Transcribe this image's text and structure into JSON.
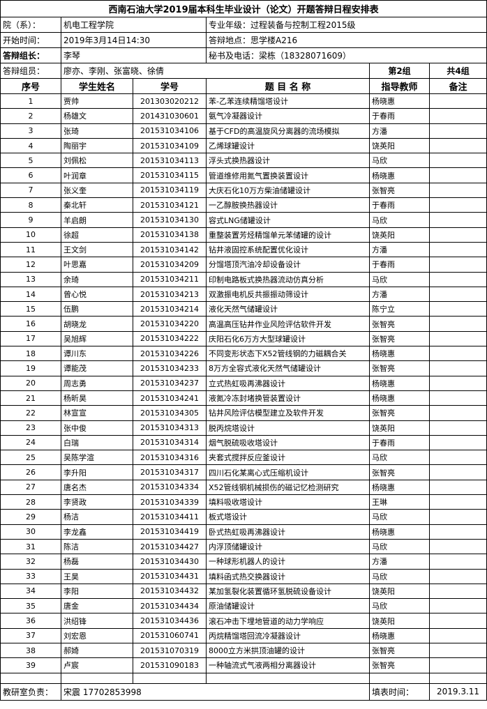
{
  "title": "西南石油大学2019届本科生毕业设计（论文）开题答辩日程安排表",
  "info": {
    "college_label": "院（系）：",
    "college_value": "机电工程学院",
    "major": "专业年级：过程装备与控制工程2015级",
    "start_label": "开始时间：",
    "start_value": "2019年3月14日14:30",
    "place": "答辩地点：思学楼A216",
    "leader_label": "答辩组长：",
    "leader_value": "李琴",
    "secretary": "秘书及电话：梁栋（18328071609）",
    "members_label": "答辩组员：",
    "members_value": "廖亦、李刚、张富晓、徐倩",
    "group": "第2组",
    "total": "共4组"
  },
  "headers": [
    "序号",
    "学生姓名",
    "学号",
    "题 目 名 称",
    "指导教师",
    "备注"
  ],
  "rows": [
    {
      "no": "1",
      "name": "贾帅",
      "id": "201303020212",
      "topic": "苯-乙苯连续精馏塔设计",
      "advisor": "杨晓惠",
      "note": ""
    },
    {
      "no": "2",
      "name": "杨雄文",
      "id": "201431030601",
      "topic": "氨气冷凝器设计",
      "advisor": "于春雨",
      "note": ""
    },
    {
      "no": "3",
      "name": "张琦",
      "id": "201531034106",
      "topic": "基于CFD的高温旋风分离器的流场模拟",
      "advisor": "方潘",
      "note": ""
    },
    {
      "no": "4",
      "name": "陶丽宇",
      "id": "201531034109",
      "topic": "乙烯球罐设计",
      "advisor": "饶英阳",
      "note": ""
    },
    {
      "no": "5",
      "name": "刘佩松",
      "id": "201531034113",
      "topic": "浮头式换热器设计",
      "advisor": "马欣",
      "note": ""
    },
    {
      "no": "6",
      "name": "叶润章",
      "id": "201531034115",
      "topic": "管道维修用氮气置换装置设计",
      "advisor": "杨晓惠",
      "note": ""
    },
    {
      "no": "7",
      "name": "张义奎",
      "id": "201531034119",
      "topic": "大庆石化10万方柴油储罐设计",
      "advisor": "张智亮",
      "note": ""
    },
    {
      "no": "8",
      "name": "秦北轩",
      "id": "201531034121",
      "topic": "一乙醇胺换热器设计",
      "advisor": "于春雨",
      "note": ""
    },
    {
      "no": "9",
      "name": "羊启朗",
      "id": "201531034130",
      "topic": "容式LNG储罐设计",
      "advisor": "马欣",
      "note": ""
    },
    {
      "no": "10",
      "name": "徐超",
      "id": "201531034138",
      "topic": "重整装置芳烃精馏单元苯储罐的设计",
      "advisor": "饶英阳",
      "note": ""
    },
    {
      "no": "11",
      "name": "王文剑",
      "id": "201531034142",
      "topic": "钻井液固控系统配置优化设计",
      "advisor": "方潘",
      "note": ""
    },
    {
      "no": "12",
      "name": "叶思嘉",
      "id": "201531034209",
      "topic": "分馏塔顶汽油冷却设备设计",
      "advisor": "于春雨",
      "note": ""
    },
    {
      "no": "13",
      "name": "余琦",
      "id": "201531034211",
      "topic": "印制电路板式换热器流动仿真分析",
      "advisor": "马欣",
      "note": ""
    },
    {
      "no": "14",
      "name": "曾心悦",
      "id": "201531034213",
      "topic": "双激振电机反共振振动筛设计",
      "advisor": "方潘",
      "note": ""
    },
    {
      "no": "15",
      "name": "伍鹏",
      "id": "201531034214",
      "topic": "液化天然气储罐设计",
      "advisor": "陈宁立",
      "note": ""
    },
    {
      "no": "16",
      "name": "胡晓龙",
      "id": "201531034220",
      "topic": "高温高压钻井作业风险评估软件开发",
      "advisor": "张智亮",
      "note": ""
    },
    {
      "no": "17",
      "name": "吴旭辉",
      "id": "201531034222",
      "topic": "庆阳石化6万方大型球罐设计",
      "advisor": "张智亮",
      "note": ""
    },
    {
      "no": "18",
      "name": "谭川东",
      "id": "201531034226",
      "topic": "不同变形状态下X52管线钢的力磁耦合关",
      "advisor": "杨晓惠",
      "note": ""
    },
    {
      "no": "19",
      "name": "谭能茂",
      "id": "201531034233",
      "topic": "8万方全容式液化天然气储罐设计",
      "advisor": "张智亮",
      "note": ""
    },
    {
      "no": "20",
      "name": "周志勇",
      "id": "201531034237",
      "topic": "立式热虹吸再沸器设计",
      "advisor": "杨晓惠",
      "note": ""
    },
    {
      "no": "21",
      "name": "杨昕昊",
      "id": "201531034241",
      "topic": "液氮冷冻封堵换管装置设计",
      "advisor": "杨晓惠",
      "note": ""
    },
    {
      "no": "22",
      "name": "林宣宣",
      "id": "201531034305",
      "topic": "钻井风险评估模型建立及软件开发",
      "advisor": "张智亮",
      "note": ""
    },
    {
      "no": "23",
      "name": "张中俊",
      "id": "201531034313",
      "topic": "脱丙烷塔设计",
      "advisor": "饶英阳",
      "note": ""
    },
    {
      "no": "24",
      "name": "白瑞",
      "id": "201531034314",
      "topic": "烟气脱硫吸收塔设计",
      "advisor": "于春雨",
      "note": ""
    },
    {
      "no": "25",
      "name": "吴陈学渲",
      "id": "201531034316",
      "topic": "夹套式搅拌反应釜设计",
      "advisor": "马欣",
      "note": ""
    },
    {
      "no": "26",
      "name": "李升阳",
      "id": "201531034317",
      "topic": "四川石化某离心式压缩机设计",
      "advisor": "张智亮",
      "note": ""
    },
    {
      "no": "27",
      "name": "唐名杰",
      "id": "201531034334",
      "topic": "X52管线钢机械损伤的磁记忆检测研究",
      "advisor": "杨晓惠",
      "note": ""
    },
    {
      "no": "28",
      "name": "李贤政",
      "id": "201531034339",
      "topic": "填料吸收塔设计",
      "advisor": "王琳",
      "note": ""
    },
    {
      "no": "29",
      "name": "杨洁",
      "id": "201531034411",
      "topic": "板式塔设计",
      "advisor": "马欣",
      "note": ""
    },
    {
      "no": "30",
      "name": "李龙鑫",
      "id": "201531034419",
      "topic": "卧式热虹吸再沸器设计",
      "advisor": "杨晓惠",
      "note": ""
    },
    {
      "no": "31",
      "name": "陈洁",
      "id": "201531034427",
      "topic": "内浮顶储罐设计",
      "advisor": "马欣",
      "note": ""
    },
    {
      "no": "32",
      "name": "杨磊",
      "id": "201531034430",
      "topic": "一种球形机器人的设计",
      "advisor": "方潘",
      "note": ""
    },
    {
      "no": "33",
      "name": "王昊",
      "id": "201531034431",
      "topic": "填料函式热交换器设计",
      "advisor": "马欣",
      "note": ""
    },
    {
      "no": "34",
      "name": "李阳",
      "id": "201531034432",
      "topic": "某加氢裂化装置循环氢脱硫设备设计",
      "advisor": "饶英阳",
      "note": ""
    },
    {
      "no": "35",
      "name": "唐金",
      "id": "201531034434",
      "topic": "原油储罐设计",
      "advisor": "马欣",
      "note": ""
    },
    {
      "no": "36",
      "name": "洪绍锋",
      "id": "201531034436",
      "topic": "滚石冲击下埋地管道的动力学响应",
      "advisor": "饶英阳",
      "note": ""
    },
    {
      "no": "37",
      "name": "刘宏恩",
      "id": "201531060741",
      "topic": "丙烷精馏塔回流冷凝器设计",
      "advisor": "杨晓惠",
      "note": ""
    },
    {
      "no": "38",
      "name": "郝婍",
      "id": "201531070319",
      "topic": "8000立方米拱顶油罐的设计",
      "advisor": "张智亮",
      "note": ""
    },
    {
      "no": "39",
      "name": "卢宸",
      "id": "201531090183",
      "topic": "一种轴流式气液两相分离器设计",
      "advisor": "张智亮",
      "note": ""
    }
  ],
  "footer": {
    "head_label": "教研室负责：",
    "head_value": "宋震 17702853998",
    "date_label": "填表时间：",
    "date_value": "2019.3.11"
  }
}
